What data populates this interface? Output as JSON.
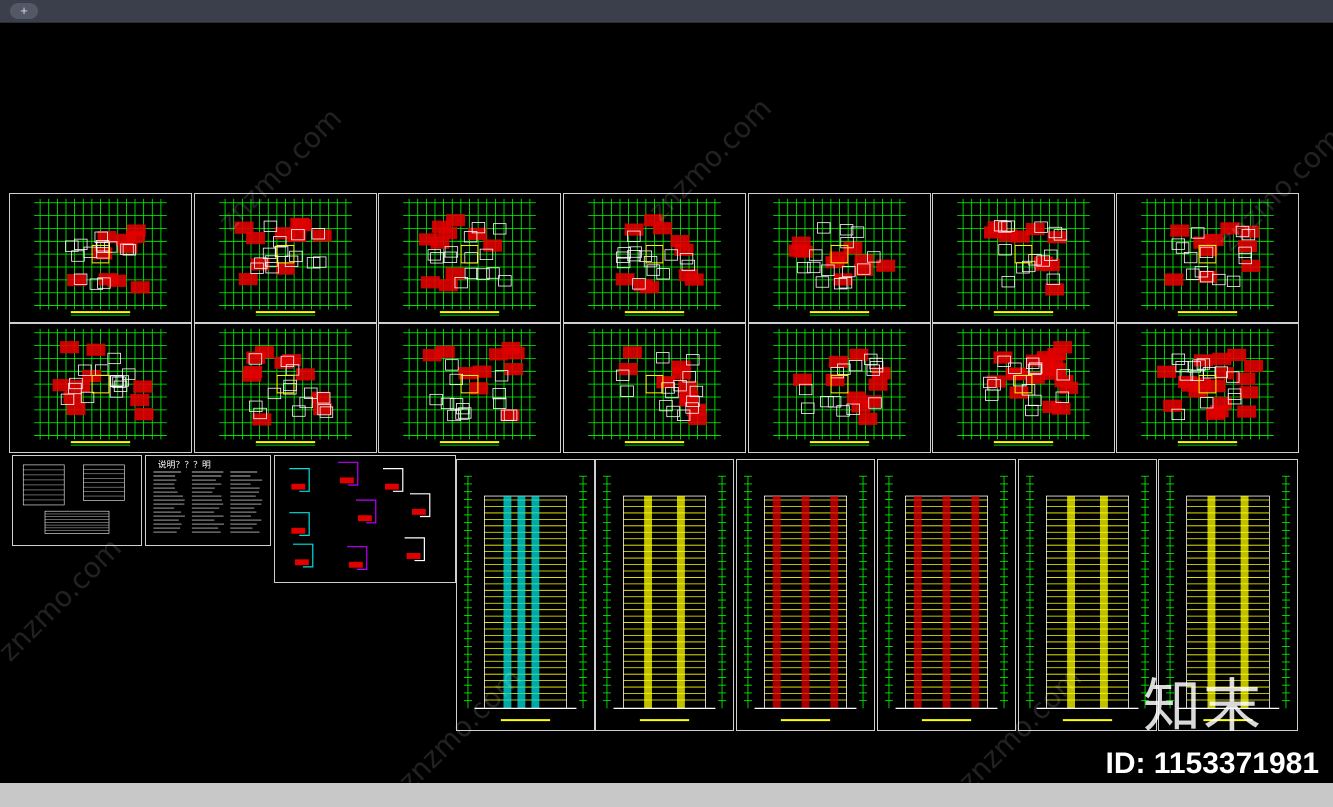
{
  "tabbar": {
    "add_label": "+"
  },
  "watermark": {
    "site": "znzmo.com",
    "brand": "知末"
  },
  "id_label": "ID: 1153371981",
  "notes_title": "说明？？？明",
  "colors": {
    "plan_red": "#e00000",
    "plan_green": "#00ff00",
    "plan_white": "#ffffff",
    "plan_yellow": "#ffff00",
    "elev_cyan": "#00e0e0",
    "accent_magenta": "#c000ff",
    "frame": "#cfcfcf"
  }
}
